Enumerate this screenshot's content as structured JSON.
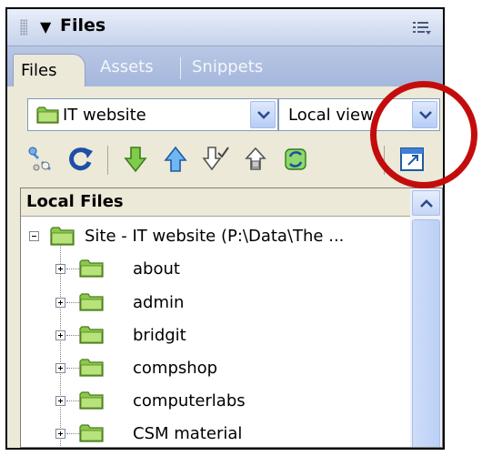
{
  "panel": {
    "title": "Files",
    "toggle_glyph": "▼"
  },
  "tabs": [
    {
      "label": "Files",
      "active": true
    },
    {
      "label": "Assets",
      "active": false
    },
    {
      "label": "Snippets",
      "active": false
    }
  ],
  "site_select": {
    "value": "IT website"
  },
  "view_select": {
    "value": "Local view"
  },
  "toolbar": {
    "icons": [
      "connect-icon",
      "refresh-icon",
      "get-files-icon",
      "put-files-icon",
      "check-out-icon",
      "check-in-icon",
      "synchronize-icon",
      "expand-collapse-icon"
    ]
  },
  "file_list": {
    "column_header": "Local Files",
    "root": "Site - IT website (P:\\Data\\The ...",
    "folders": [
      {
        "name": "about"
      },
      {
        "name": "admin"
      },
      {
        "name": "bridgit"
      },
      {
        "name": "compshop"
      },
      {
        "name": "computerlabs"
      },
      {
        "name": "CSM material"
      }
    ]
  },
  "colors": {
    "annotation_ring": "#c30d0d",
    "folder_fill": "#a6d86b",
    "header_bg": "#c6d3ec"
  }
}
